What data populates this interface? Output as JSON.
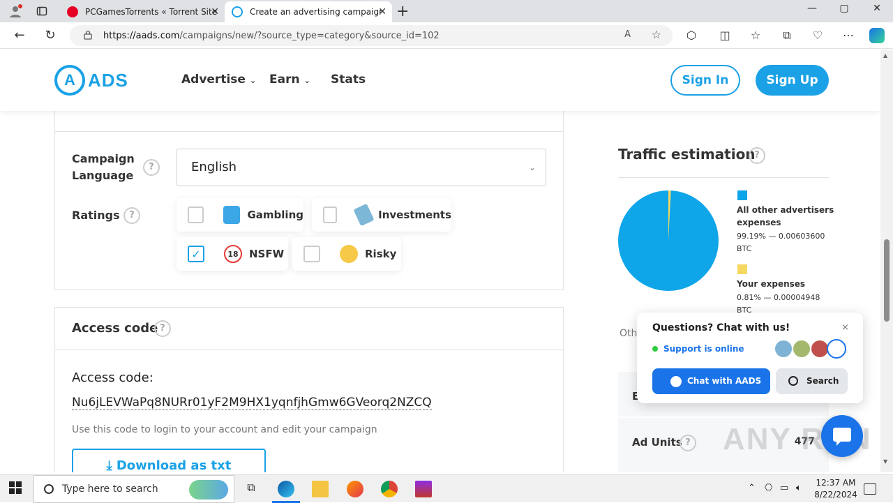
{
  "browser": {
    "tabs": [
      {
        "title": "PCGamesTorrents « Torrent Site f",
        "active": false
      },
      {
        "title": "Create an advertising campaign |",
        "active": true
      }
    ],
    "url_host": "https://aads.com",
    "url_path": "/campaigns/new/?source_type=category&source_id=102",
    "window_controls": {
      "minimize": "—",
      "maximize": "▢",
      "close": "✕"
    },
    "new_tab": "+"
  },
  "header": {
    "logo_letter": "A",
    "logo_text": "ADS",
    "nav": [
      "Advertise",
      "Earn",
      "Stats"
    ],
    "sign_in": "Sign In",
    "sign_up": "Sign Up"
  },
  "settings": {
    "language_label": "Campaign Language",
    "language_value": "English",
    "ratings_label": "Ratings",
    "ratings": [
      {
        "label": "Gambling",
        "checked": false
      },
      {
        "label": "Investments",
        "checked": false
      },
      {
        "label": "NSFW",
        "checked": true
      },
      {
        "label": "Risky",
        "checked": false
      }
    ],
    "nsfw_icon_text": "18"
  },
  "access": {
    "title": "Access code",
    "label": "Access code:",
    "code": "Nu6jLEVWaPq8NURr01yF2M9HX1yqnfjhGmw6GVeorq2NZCQ",
    "hint": "Use this code to login to your account and edit your campaign",
    "download": "Download as txt"
  },
  "traffic": {
    "title": "Traffic estimation",
    "legend": [
      {
        "title": "All other advertisers expenses",
        "value": "99.19% — 0.00603600 BTC",
        "color": "#0ea5e9"
      },
      {
        "title": "Your expenses",
        "value": "0.81% — 0.00004948 BTC",
        "color": "#f6d860"
      }
    ],
    "other_label": "Oth",
    "row1_key": "E",
    "ad_units_label": "Ad Units",
    "ad_units_value": "477"
  },
  "chart_data": {
    "type": "pie",
    "categories": [
      "All other advertisers expenses",
      "Your expenses"
    ],
    "values": [
      99.19,
      0.81
    ],
    "colors": [
      "#0ea5e9",
      "#f6d860"
    ]
  },
  "chat": {
    "question": "Questions? Chat with us!",
    "status": "Support is online",
    "chat_button": "Chat with AADS",
    "search_button": "Search",
    "close": "×"
  },
  "watermark": "ANY RUN",
  "taskbar": {
    "search_placeholder": "Type here to search",
    "time": "12:37 AM",
    "date": "8/22/2024"
  }
}
